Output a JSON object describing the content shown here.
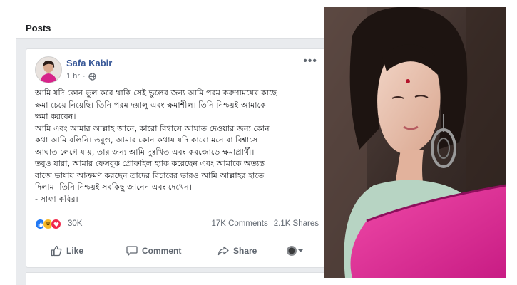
{
  "colors": {
    "fb_link": "#385898",
    "page_bg": "#e9ebee",
    "saree_pink": "#e0309b",
    "kurta_green": "#b7d4c3"
  },
  "posts_header": {
    "title": "Posts"
  },
  "post": {
    "author": "Safa Kabir",
    "time": "1 hr",
    "audience_icon": "globe-icon",
    "body": "আমি যদি কোন ভুল করে থাকি সেই ভুলের জন্য আমি পরম করুণাময়ের কাছে\nক্ষমা চেয়ে নিয়েছি। তিনি পরম দয়ালু এবং ক্ষমাশীল। তিনি নিশ্চয়ই আমাকে\nক্ষমা করবেন।\nআমি এবং আমার আল্লাহ জানে, কারো বিশ্বাসে আঘাত দেওয়ার জন্য কোন\nকথা আমি বলিনি। তবুও, আমার কোন কথায় যদি কারো মনে বা বিশ্বাসে\nআঘাত লেগে যায়, তার জন্য আমি দুঃখিত এবং করজোড়ে ক্ষমাপ্রার্থী।\nতবুও যারা, আমার ফেসবুক প্রোফাইল হ্যাক করেছেন এবং আমাকে অত্যন্ত\nবাজে ভাষায় আক্রমণ করছেন তাদের বিচারের ভারও আমি আল্লাহর হাতে\nদিলাম। তিনি নিশ্চয়ই সবকিছু জানেন এবং দেখেন।\n- সাফা কবির।",
    "reactions": {
      "icons": [
        "like-icon",
        "haha-icon",
        "love-icon"
      ],
      "count": "30K"
    },
    "comments": "17K Comments",
    "shares": "2.1K Shares",
    "actions": {
      "like": "Like",
      "comment": "Comment",
      "share": "Share"
    }
  }
}
